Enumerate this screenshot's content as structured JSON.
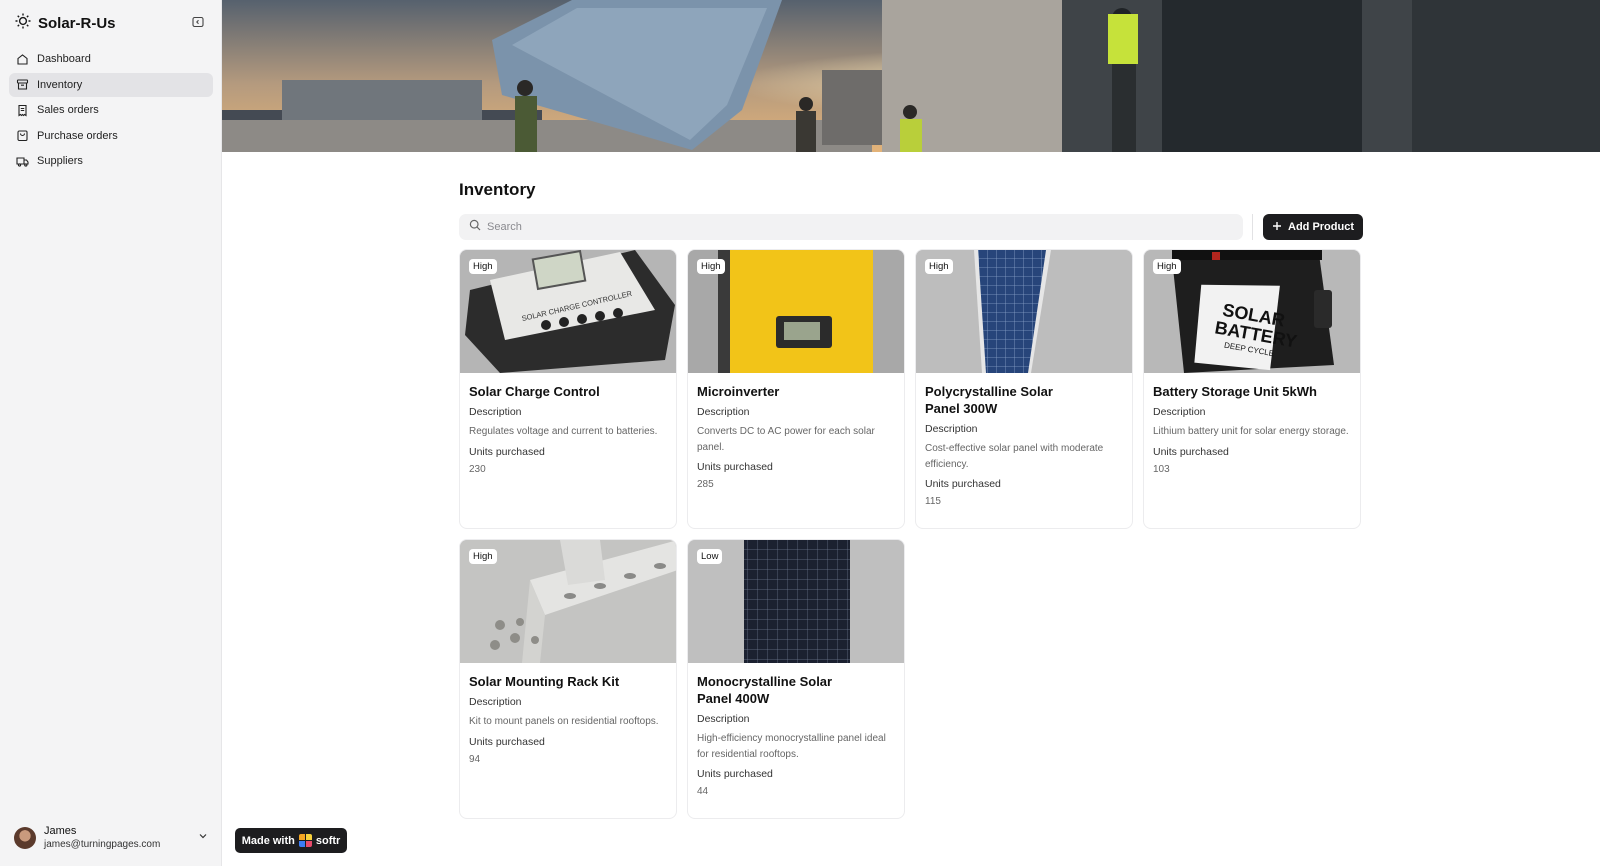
{
  "brand": {
    "name": "Solar-R-Us",
    "logo_icon": "sun-icon"
  },
  "sidebar": {
    "items": [
      {
        "label": "Dashboard",
        "icon": "home-icon",
        "active": false
      },
      {
        "label": "Inventory",
        "icon": "archive-icon",
        "active": true
      },
      {
        "label": "Sales orders",
        "icon": "receipt-icon",
        "active": false
      },
      {
        "label": "Purchase orders",
        "icon": "bag-icon",
        "active": false
      },
      {
        "label": "Suppliers",
        "icon": "truck-icon",
        "active": false
      }
    ],
    "user": {
      "name": "James",
      "email": "james@turningpages.com"
    }
  },
  "main": {
    "title": "Inventory",
    "search_placeholder": "Search",
    "add_button_label": "Add Product",
    "field_labels": {
      "description": "Description",
      "units": "Units purchased"
    },
    "products": [
      {
        "name": "Solar Charge Control",
        "badge": "High",
        "description": "Regulates voltage and current to batteries.",
        "units": "230"
      },
      {
        "name": "Microinverter",
        "badge": "High",
        "description": "Converts DC to AC power for each solar panel.",
        "units": "285"
      },
      {
        "name": "Polycrystalline Solar Panel 300W",
        "badge": "High",
        "description": "Cost-effective solar panel with moderate efficiency.",
        "units": "115"
      },
      {
        "name": "Battery Storage Unit 5kWh",
        "badge": "High",
        "description": "Lithium battery unit for solar energy storage.",
        "units": "103"
      },
      {
        "name": "Solar Mounting Rack Kit",
        "badge": "High",
        "description": "Kit to mount panels on residential rooftops.",
        "units": "94"
      },
      {
        "name": "Monocrystalline Solar Panel 400W",
        "badge": "Low",
        "description": "High-efficiency monocrystalline panel ideal for residential rooftops.",
        "units": "44"
      }
    ]
  },
  "product_images": {
    "charge_controller": [
      "SOLAR CHARGE CONTROLLER"
    ],
    "battery": [
      "SOLAR",
      "BATTERY",
      "DEEP CYCLE"
    ]
  },
  "footer": {
    "made_with": "Made with",
    "brand": "softr"
  },
  "colors": {
    "accent": "#1d1d1f",
    "sidebar_bg": "#f4f4f5",
    "active_bg": "#e3e3e6",
    "yellow": "#f2c418"
  }
}
